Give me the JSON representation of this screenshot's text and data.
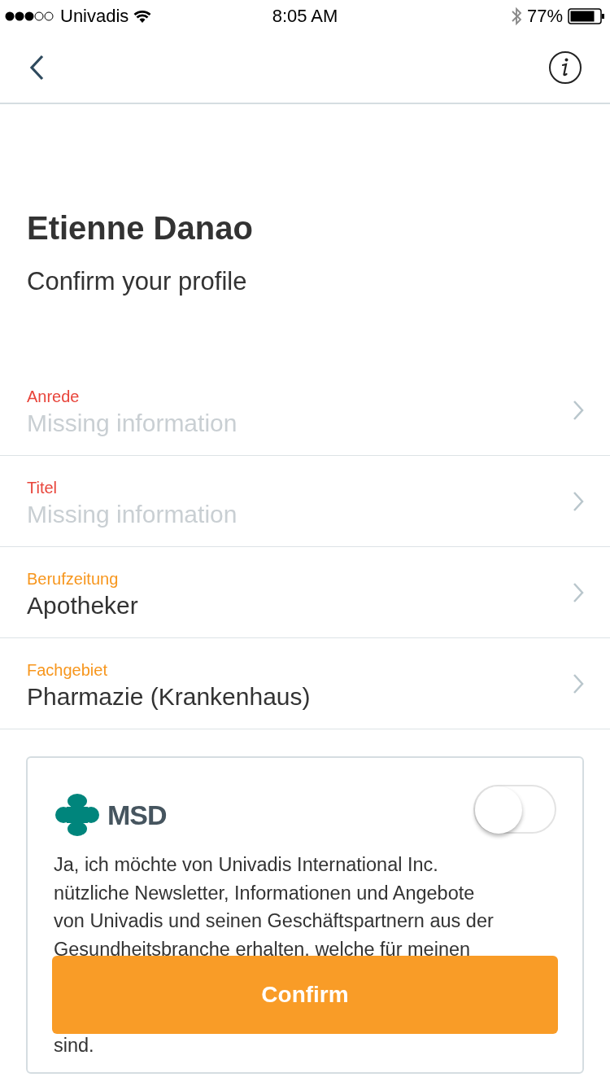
{
  "status_bar": {
    "carrier": "Univadis",
    "time": "8:05 AM",
    "battery": "77%"
  },
  "header": {
    "name": "Etienne Danao",
    "subtitle": "Confirm your profile"
  },
  "fields": [
    {
      "label": "Anrede",
      "value": "Missing information",
      "missing": true
    },
    {
      "label": "Titel",
      "value": "Missing information",
      "missing": true
    },
    {
      "label": "Berufzeitung",
      "value": "Apotheker",
      "missing": false
    },
    {
      "label": "Fachgebiet",
      "value": "Pharmazie (Krankenhaus)",
      "missing": false
    }
  ],
  "consent": {
    "logo_text": "MSD",
    "on": false,
    "text": "Ja, ich möchte von Univadis International Inc. nützliche Newsletter, Informationen und Angebote von Univadis und seinen Geschäftspartnern aus der Gesundheitsbranche erhalten, welche für meinen",
    "text_end": "sind."
  },
  "confirm_button": "Confirm"
}
